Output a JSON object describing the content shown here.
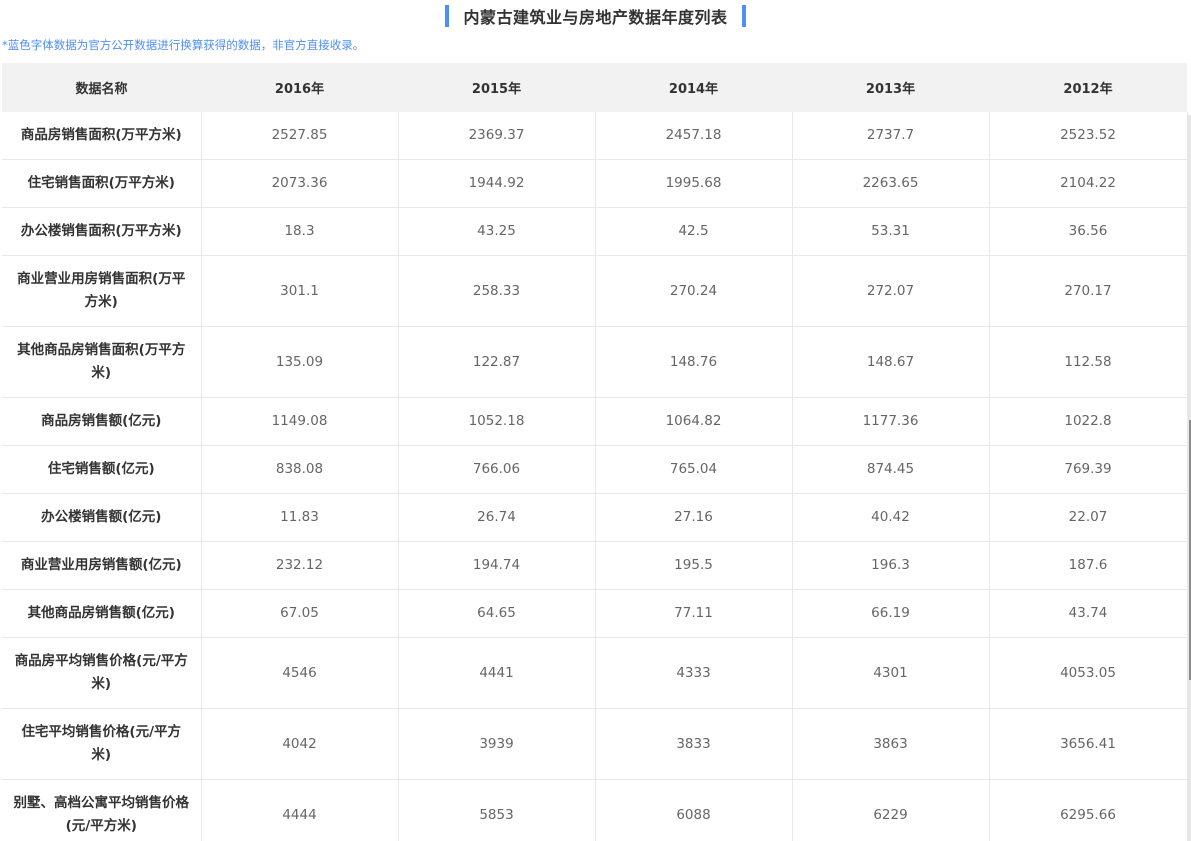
{
  "header": {
    "title": "内蒙古建筑业与房地产数据年度列表",
    "note": "*蓝色字体数据为官方公开数据进行换算获得的数据，非官方直接收录。"
  },
  "colors": {
    "accent": "#4f8ef7",
    "header_bg": "#f2f2f2",
    "border": "#e8e8e8"
  },
  "table": {
    "columns": [
      "数据名称",
      "2016年",
      "2015年",
      "2014年",
      "2013年",
      "2012年"
    ],
    "rows": [
      {
        "name": "商品房销售面积(万平方米)",
        "values": [
          "2527.85",
          "2369.37",
          "2457.18",
          "2737.7",
          "2523.52"
        ],
        "tall": false
      },
      {
        "name": "住宅销售面积(万平方米)",
        "values": [
          "2073.36",
          "1944.92",
          "1995.68",
          "2263.65",
          "2104.22"
        ],
        "tall": false
      },
      {
        "name": "办公楼销售面积(万平方米)",
        "values": [
          "18.3",
          "43.25",
          "42.5",
          "53.31",
          "36.56"
        ],
        "tall": false
      },
      {
        "name": "商业营业用房销售面积(万平方米)",
        "values": [
          "301.1",
          "258.33",
          "270.24",
          "272.07",
          "270.17"
        ],
        "tall": true
      },
      {
        "name": "其他商品房销售面积(万平方米)",
        "values": [
          "135.09",
          "122.87",
          "148.76",
          "148.67",
          "112.58"
        ],
        "tall": true
      },
      {
        "name": "商品房销售额(亿元)",
        "values": [
          "1149.08",
          "1052.18",
          "1064.82",
          "1177.36",
          "1022.8"
        ],
        "tall": false
      },
      {
        "name": "住宅销售额(亿元)",
        "values": [
          "838.08",
          "766.06",
          "765.04",
          "874.45",
          "769.39"
        ],
        "tall": false
      },
      {
        "name": "办公楼销售额(亿元)",
        "values": [
          "11.83",
          "26.74",
          "27.16",
          "40.42",
          "22.07"
        ],
        "tall": false
      },
      {
        "name": "商业营业用房销售额(亿元)",
        "values": [
          "232.12",
          "194.74",
          "195.5",
          "196.3",
          "187.6"
        ],
        "tall": false
      },
      {
        "name": "其他商品房销售额(亿元)",
        "values": [
          "67.05",
          "64.65",
          "77.11",
          "66.19",
          "43.74"
        ],
        "tall": false
      },
      {
        "name": "商品房平均销售价格(元/平方米)",
        "values": [
          "4546",
          "4441",
          "4333",
          "4301",
          "4053.05"
        ],
        "tall": true
      },
      {
        "name": "住宅平均销售价格(元/平方米)",
        "values": [
          "4042",
          "3939",
          "3833",
          "3863",
          "3656.41"
        ],
        "tall": true
      },
      {
        "name": "别墅、高档公寓平均销售价格(元/平方米)",
        "values": [
          "4444",
          "5853",
          "6088",
          "6229",
          "6295.66"
        ],
        "tall": true
      }
    ]
  }
}
